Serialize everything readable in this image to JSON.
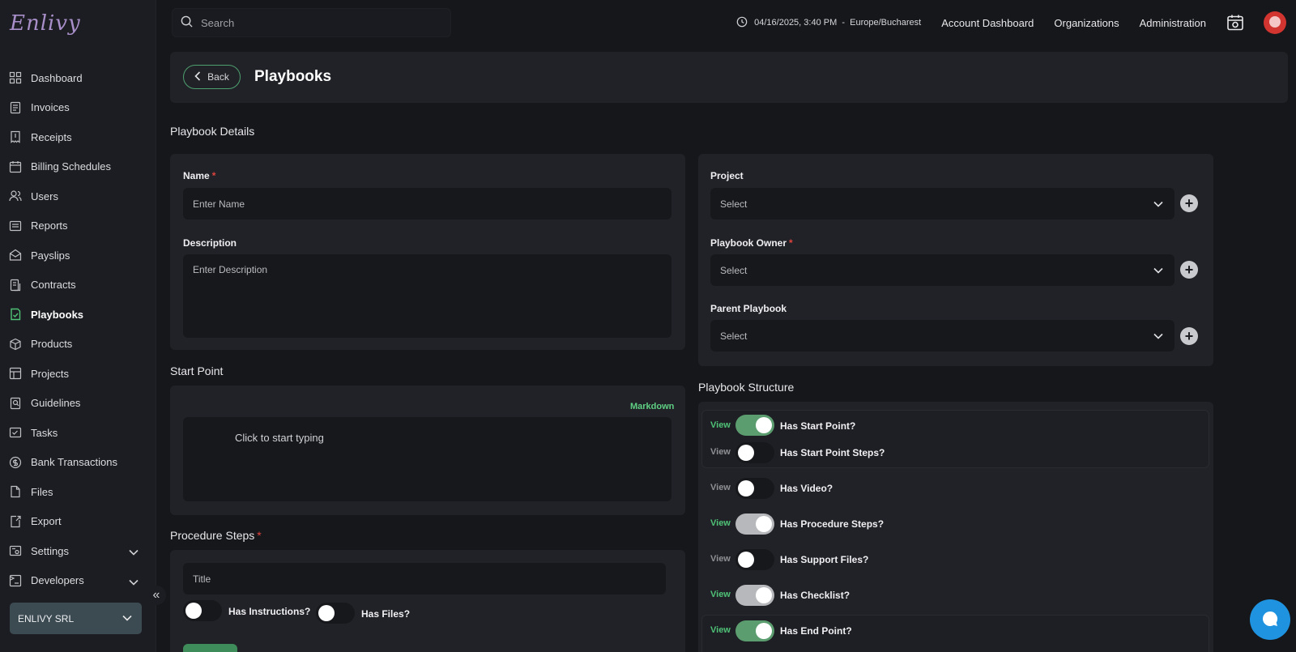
{
  "app": {
    "logo": "Enlivy"
  },
  "sidebar": {
    "items": [
      {
        "label": "Dashboard",
        "icon": "dashboard-icon"
      },
      {
        "label": "Invoices",
        "icon": "invoice-icon"
      },
      {
        "label": "Receipts",
        "icon": "receipt-icon"
      },
      {
        "label": "Billing Schedules",
        "icon": "billing-schedule-icon"
      },
      {
        "label": "Users",
        "icon": "users-icon"
      },
      {
        "label": "Reports",
        "icon": "reports-icon"
      },
      {
        "label": "Payslips",
        "icon": "payslip-icon"
      },
      {
        "label": "Contracts",
        "icon": "contract-icon"
      },
      {
        "label": "Playbooks",
        "icon": "playbook-icon",
        "active": true
      },
      {
        "label": "Products",
        "icon": "product-icon"
      },
      {
        "label": "Projects",
        "icon": "project-icon"
      },
      {
        "label": "Guidelines",
        "icon": "guideline-icon"
      },
      {
        "label": "Tasks",
        "icon": "task-icon"
      },
      {
        "label": "Bank Transactions",
        "icon": "bank-icon"
      },
      {
        "label": "Files",
        "icon": "file-icon"
      },
      {
        "label": "Export",
        "icon": "export-icon"
      },
      {
        "label": "Settings",
        "icon": "settings-icon",
        "expandable": true
      },
      {
        "label": "Developers",
        "icon": "developers-icon",
        "expandable": true
      }
    ],
    "organization": "ENLIVY SRL"
  },
  "topbar": {
    "search_placeholder": "Search",
    "datetime": "04/16/2025, 3:40 PM",
    "timezone": "Europe/Bucharest",
    "links": [
      "Account Dashboard",
      "Organizations",
      "Administration"
    ]
  },
  "header": {
    "back_label": "Back",
    "title": "Playbooks"
  },
  "details": {
    "section_title": "Playbook Details",
    "name_label": "Name",
    "name_placeholder": "Enter Name",
    "description_label": "Description",
    "description_placeholder": "Enter Description",
    "project_label": "Project",
    "project_value": "Select",
    "owner_label": "Playbook Owner",
    "owner_value": "Select",
    "parent_label": "Parent Playbook",
    "parent_value": "Select"
  },
  "start_point": {
    "section_title": "Start Point",
    "markdown_label": "Markdown",
    "editor_placeholder": "Click to start typing"
  },
  "procedure_steps": {
    "section_title": "Procedure Steps",
    "title_placeholder": "Title",
    "has_instructions_label": "Has Instructions?",
    "has_files_label": "Has Files?"
  },
  "structure": {
    "section_title": "Playbook Structure",
    "view_label": "View",
    "toggles": [
      {
        "label": "Has Start Point?",
        "state": "on-green",
        "view_active": true
      },
      {
        "label": "Has Start Point Steps?",
        "state": "off",
        "view_active": false
      },
      {
        "label": "Has Video?",
        "state": "off",
        "view_active": false
      },
      {
        "label": "Has Procedure Steps?",
        "state": "on-gray",
        "view_active": true
      },
      {
        "label": "Has Support Files?",
        "state": "off",
        "view_active": false
      },
      {
        "label": "Has Checklist?",
        "state": "on-gray",
        "view_active": true
      },
      {
        "label": "Has End Point?",
        "state": "on-green",
        "view_active": true
      }
    ]
  },
  "colors": {
    "accent_green": "#4fc277",
    "background": "#16171b",
    "card": "#212227",
    "chat_blue": "#1f93e0"
  }
}
